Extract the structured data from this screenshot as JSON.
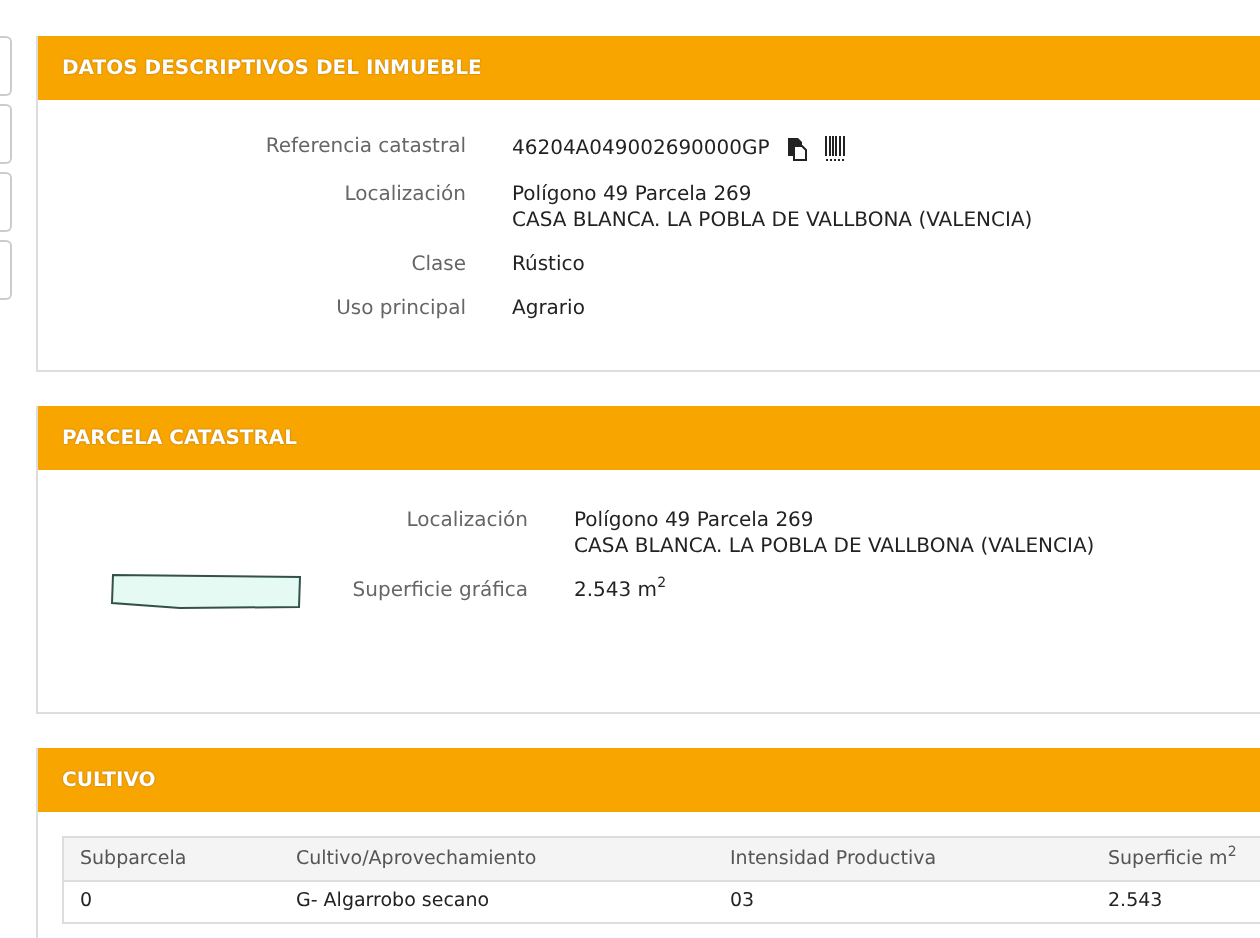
{
  "side_tabs": [
    {
      "kind": "tab"
    },
    {
      "kind": "tab"
    },
    {
      "kind": "tab"
    },
    {
      "kind": "tab"
    }
  ],
  "inmueble": {
    "title": "DATOS DESCRIPTIVOS DEL INMUEBLE",
    "fields": [
      {
        "label": "Referencia catastral",
        "lines": [
          "46204A049002690000GP"
        ],
        "kind": "reference"
      },
      {
        "label": "Localización",
        "lines": [
          "Polígono 49 Parcela 269",
          "CASA BLANCA. LA POBLA DE VALLBONA (VALENCIA)"
        ],
        "kind": "text"
      },
      {
        "label": "Clase",
        "lines": [
          "Rústico"
        ],
        "kind": "text"
      },
      {
        "label": "Uso principal",
        "lines": [
          "Agrario"
        ],
        "kind": "text"
      }
    ]
  },
  "parcela": {
    "title": "PARCELA CATASTRAL",
    "fields": [
      {
        "label": "Localización",
        "lines": [
          "Polígono 49 Parcela 269",
          "CASA BLANCA. LA POBLA DE VALLBONA (VALENCIA)"
        ]
      },
      {
        "label": "Superficie gráfica",
        "lines": [
          "2.543 m$^{2}$"
        ]
      }
    ]
  },
  "cultivo": {
    "title": "CULTIVO",
    "columns": [
      "Subparcela",
      "Cultivo/Aprovechamiento",
      "Intensidad Productiva",
      "Superficie m$^{2}$"
    ],
    "rows": [
      [
        "0",
        "G- Algarrobo secano",
        "03",
        "2.543"
      ]
    ]
  }
}
